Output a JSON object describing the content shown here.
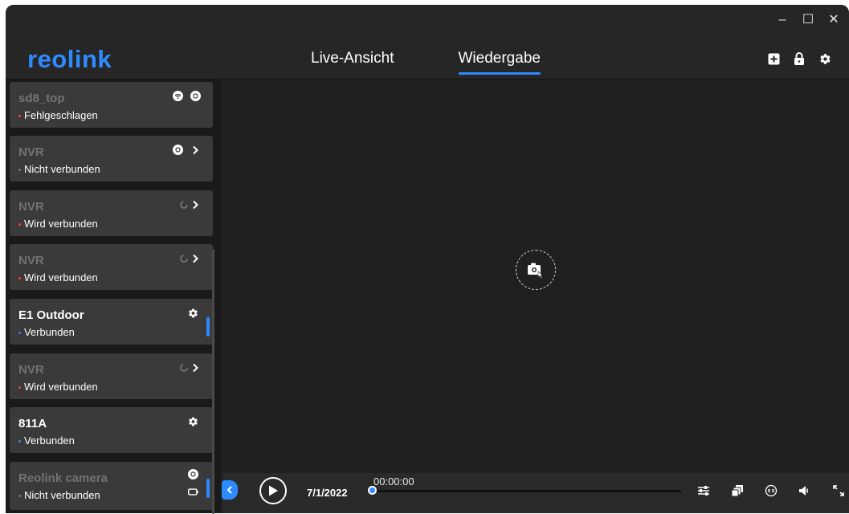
{
  "window": {
    "minimize_label": "–",
    "maximize_label": "☐",
    "close_label": "✕"
  },
  "header": {
    "logo": "reolink",
    "tabs": [
      {
        "label": "Live-Ansicht",
        "active": false
      },
      {
        "label": "Wiedergabe",
        "active": true
      }
    ],
    "icons": [
      "add-device-icon",
      "lock-icon",
      "settings-icon"
    ]
  },
  "devices": [
    {
      "name": "sd8_top",
      "status": "Fehlgeschlagen",
      "status_color": "#ff3b3b",
      "online": false,
      "icons": [
        "wifi-icon",
        "battery-icon"
      ]
    },
    {
      "name": "NVR",
      "status": "Nicht verbunden",
      "status_color": "#7a7a7a",
      "online": false,
      "icons": [
        "battery-icon",
        "chevron-right-icon"
      ]
    },
    {
      "name": "NVR",
      "status": "Wird verbunden",
      "status_color": "#ff3b3b",
      "online": false,
      "icons": [
        "loading-icon",
        "chevron-right-icon"
      ]
    },
    {
      "name": "NVR",
      "status": "Wird verbunden",
      "status_color": "#ff3b3b",
      "online": false,
      "icons": [
        "loading-icon",
        "chevron-right-icon"
      ]
    },
    {
      "name": "E1 Outdoor",
      "status": "Verbunden",
      "status_color": "#2e8bff",
      "online": true,
      "icons": [
        "gear-icon"
      ]
    },
    {
      "name": "NVR",
      "status": "Wird verbunden",
      "status_color": "#ff3b3b",
      "online": false,
      "icons": [
        "loading-icon",
        "chevron-right-icon"
      ]
    },
    {
      "name": "811A",
      "status": "Verbunden",
      "status_color": "#2e8bff",
      "online": true,
      "icons": [
        "gear-icon"
      ]
    },
    {
      "name": "Reolink camera",
      "status": "Nicht verbunden",
      "status_color": "#7a7a7a",
      "online": false,
      "icons": [
        "battery-icon",
        "battery-level-icon"
      ]
    }
  ],
  "player": {
    "date": "7/1/2022",
    "time": "00:00:00",
    "progress": 0.0
  },
  "colors": {
    "accent": "#2e8bff",
    "background": "#1f1f1f"
  }
}
